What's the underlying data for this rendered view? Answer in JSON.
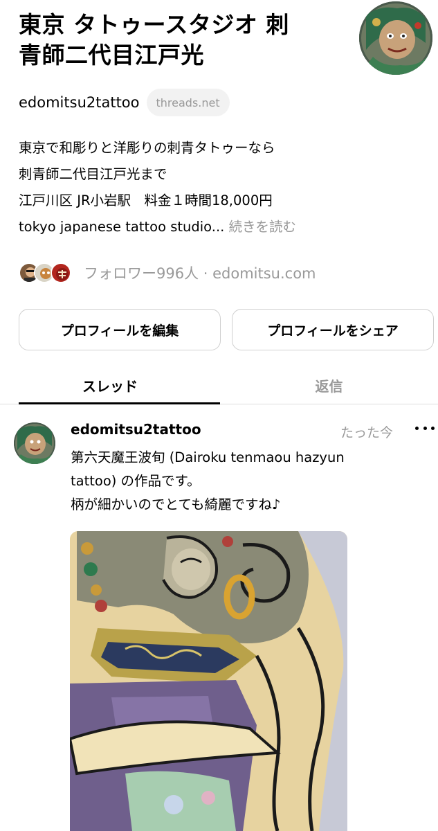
{
  "profile": {
    "name_line1": "東京 タトゥースタジオ 刺",
    "name_line2": "青師二代目江戸光",
    "avatar_icon": "profile-avatar-tattoo-art",
    "handle": "edomitsu2tattoo",
    "domain_badge": "threads.net",
    "bio_lines": [
      "東京で和彫りと洋彫りの刺青タトゥーなら",
      "刺青師二代目江戸光まで",
      "江戸川区 JR小岩駅　料金１時間18,000円"
    ],
    "bio_last_line": "tokyo japanese tattoo studio...",
    "bio_more": "続きを読む",
    "followers_text": "フォロワー996人 · edomitsu.com"
  },
  "buttons": {
    "edit_profile": "プロフィールを編集",
    "share_profile": "プロフィールをシェア"
  },
  "tabs": {
    "threads": "スレッド",
    "replies": "返信",
    "active": "threads"
  },
  "post": {
    "username": "edomitsu2tattoo",
    "time": "たった今",
    "text_lines": [
      "第六天魔王波旬 (Dairoku tenmaou hazyun",
      "tattoo) の作品です。",
      "柄が細かいのでとても綺麗ですね♪"
    ],
    "more_icon": "more-horizontal-icon"
  },
  "colors": {
    "text_primary": "#000000",
    "text_secondary": "#999999",
    "divider": "#dcdcdc",
    "button_border": "#cfcfcf",
    "pill_bg": "#f2f2f2"
  }
}
